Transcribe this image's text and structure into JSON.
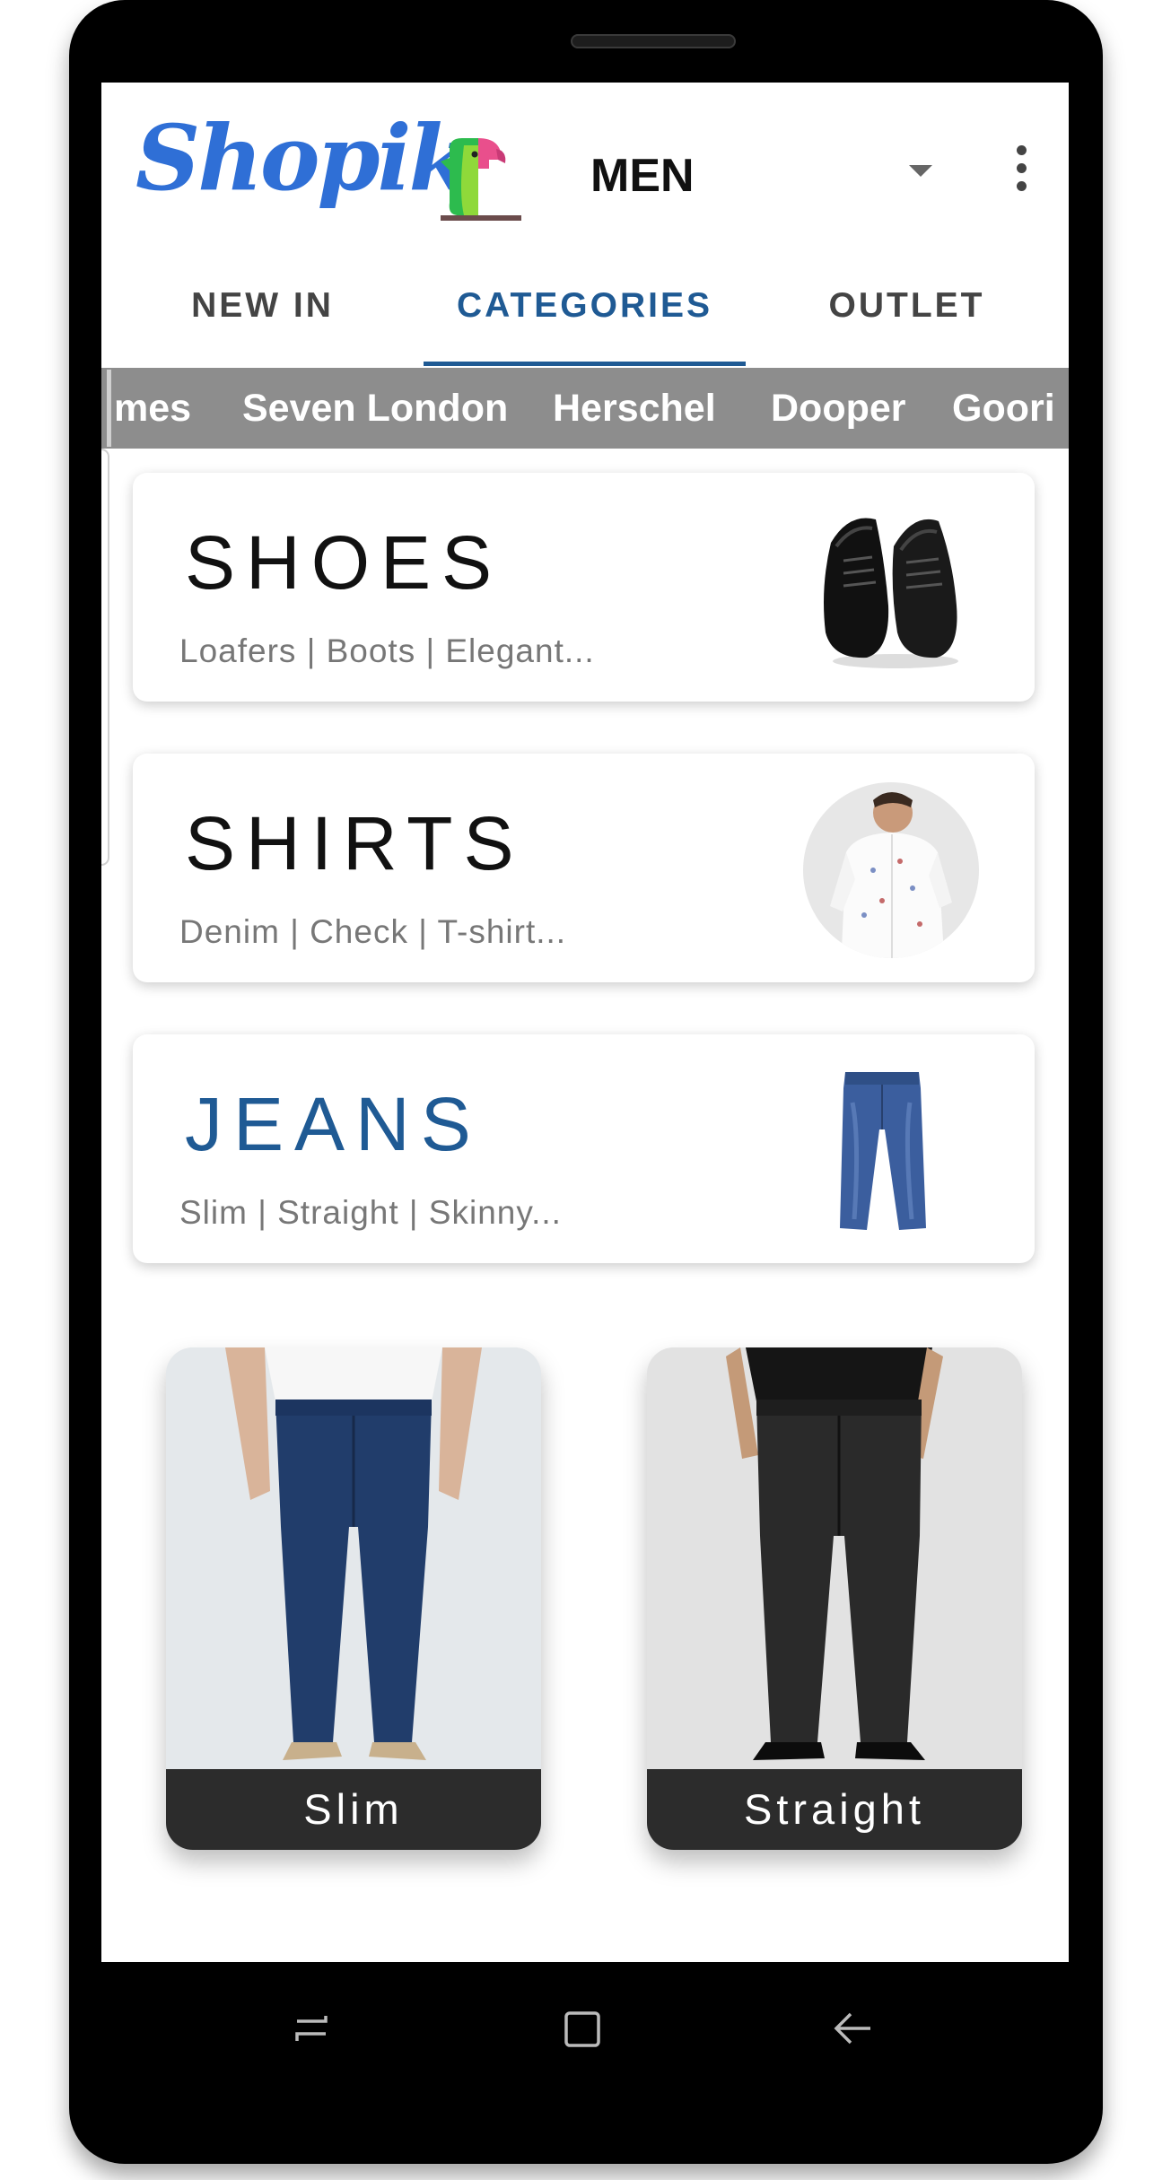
{
  "app": {
    "logo_text": "Shopik",
    "gender": "MEN",
    "colors": {
      "primary": "#1f5a94",
      "logo_blue": "#2f6fd6",
      "brand_bar": "#8d8d8d",
      "tile_label_bg": "#2c2c2c"
    }
  },
  "icons": {
    "menu": "more-vert-icon",
    "dropdown": "caret-down-icon"
  },
  "tabs": [
    {
      "label": "NEW IN",
      "active": false
    },
    {
      "label": "CATEGORIES",
      "active": true
    },
    {
      "label": "OUTLET",
      "active": false
    }
  ],
  "brands": [
    "mes",
    "Seven London",
    "Herschel",
    "Dooper",
    "Goori"
  ],
  "categories": [
    {
      "title": "SHOES",
      "subtitle": "Loafers | Boots | Elegant...",
      "selected": false
    },
    {
      "title": "SHIRTS",
      "subtitle": "Denim | Check | T-shirt...",
      "selected": false
    },
    {
      "title": "JEANS",
      "subtitle": "Slim | Straight | Skinny...",
      "selected": true
    }
  ],
  "subcategories": [
    {
      "label": "Slim"
    },
    {
      "label": "Straight"
    }
  ],
  "navigation": [
    "recent-apps-icon",
    "home-icon",
    "back-icon"
  ]
}
